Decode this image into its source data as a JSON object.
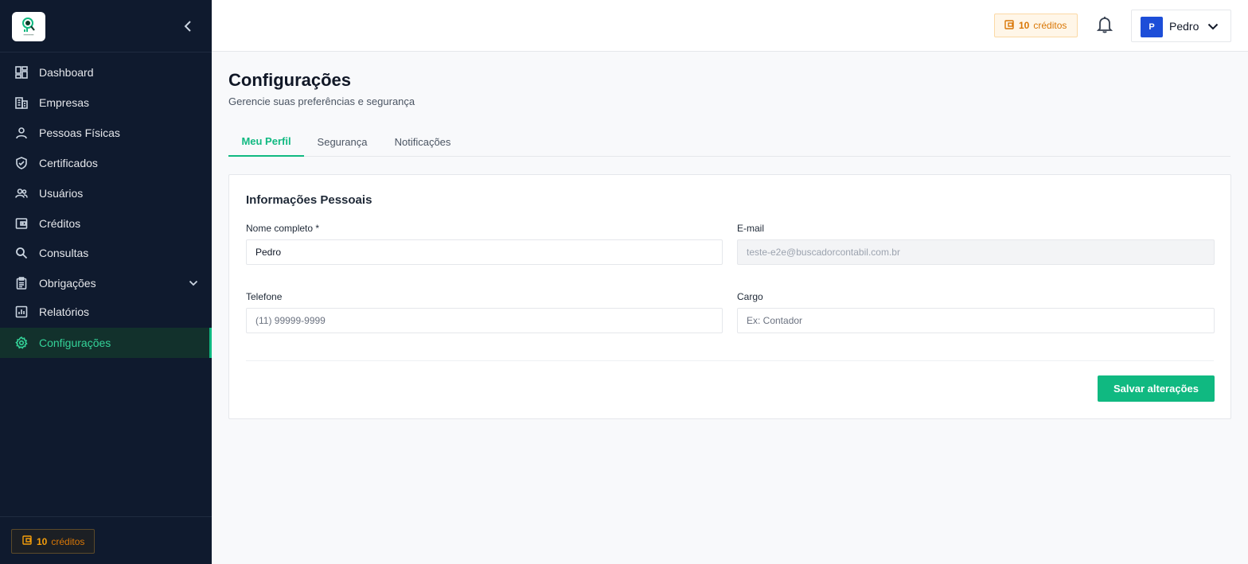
{
  "sidebar": {
    "collapse_icon": "chevron-left-icon",
    "items": [
      {
        "label": "Dashboard",
        "icon": "dashboard-icon"
      },
      {
        "label": "Empresas",
        "icon": "building-icon"
      },
      {
        "label": "Pessoas Físicas",
        "icon": "person-icon"
      },
      {
        "label": "Certificados",
        "icon": "shield-check-icon"
      },
      {
        "label": "Usuários",
        "icon": "users-icon"
      },
      {
        "label": "Créditos",
        "icon": "wallet-icon"
      },
      {
        "label": "Consultas",
        "icon": "search-icon"
      },
      {
        "label": "Obrigações",
        "icon": "clipboard-icon"
      },
      {
        "label": "Relatórios",
        "icon": "chart-icon"
      },
      {
        "label": "Configurações",
        "icon": "gear-icon",
        "active": true
      }
    ],
    "credits": {
      "amount": "10",
      "label": "créditos"
    }
  },
  "header": {
    "credits": {
      "amount": "10",
      "label": "créditos"
    },
    "notifications_icon": "bell-icon",
    "user": {
      "initial": "P",
      "name": "Pedro"
    }
  },
  "page": {
    "title": "Configurações",
    "subtitle": "Gerencie suas preferências e segurança"
  },
  "tabs": [
    {
      "label": "Meu Perfil",
      "active": true
    },
    {
      "label": "Segurança"
    },
    {
      "label": "Notificações"
    }
  ],
  "form": {
    "section_title": "Informações Pessoais",
    "name": {
      "label": "Nome completo *",
      "value": "Pedro"
    },
    "email": {
      "label": "E-mail",
      "value": "teste-e2e@buscadorcontabil.com.br"
    },
    "phone": {
      "label": "Telefone",
      "placeholder": "(11) 99999-9999"
    },
    "role": {
      "label": "Cargo",
      "placeholder": "Ex: Contador"
    },
    "save_label": "Salvar alterações"
  },
  "colors": {
    "sidebar_bg": "#0f1a2e",
    "accent": "#10b981",
    "credits": "#d97706",
    "avatar": "#1d4ed8"
  }
}
